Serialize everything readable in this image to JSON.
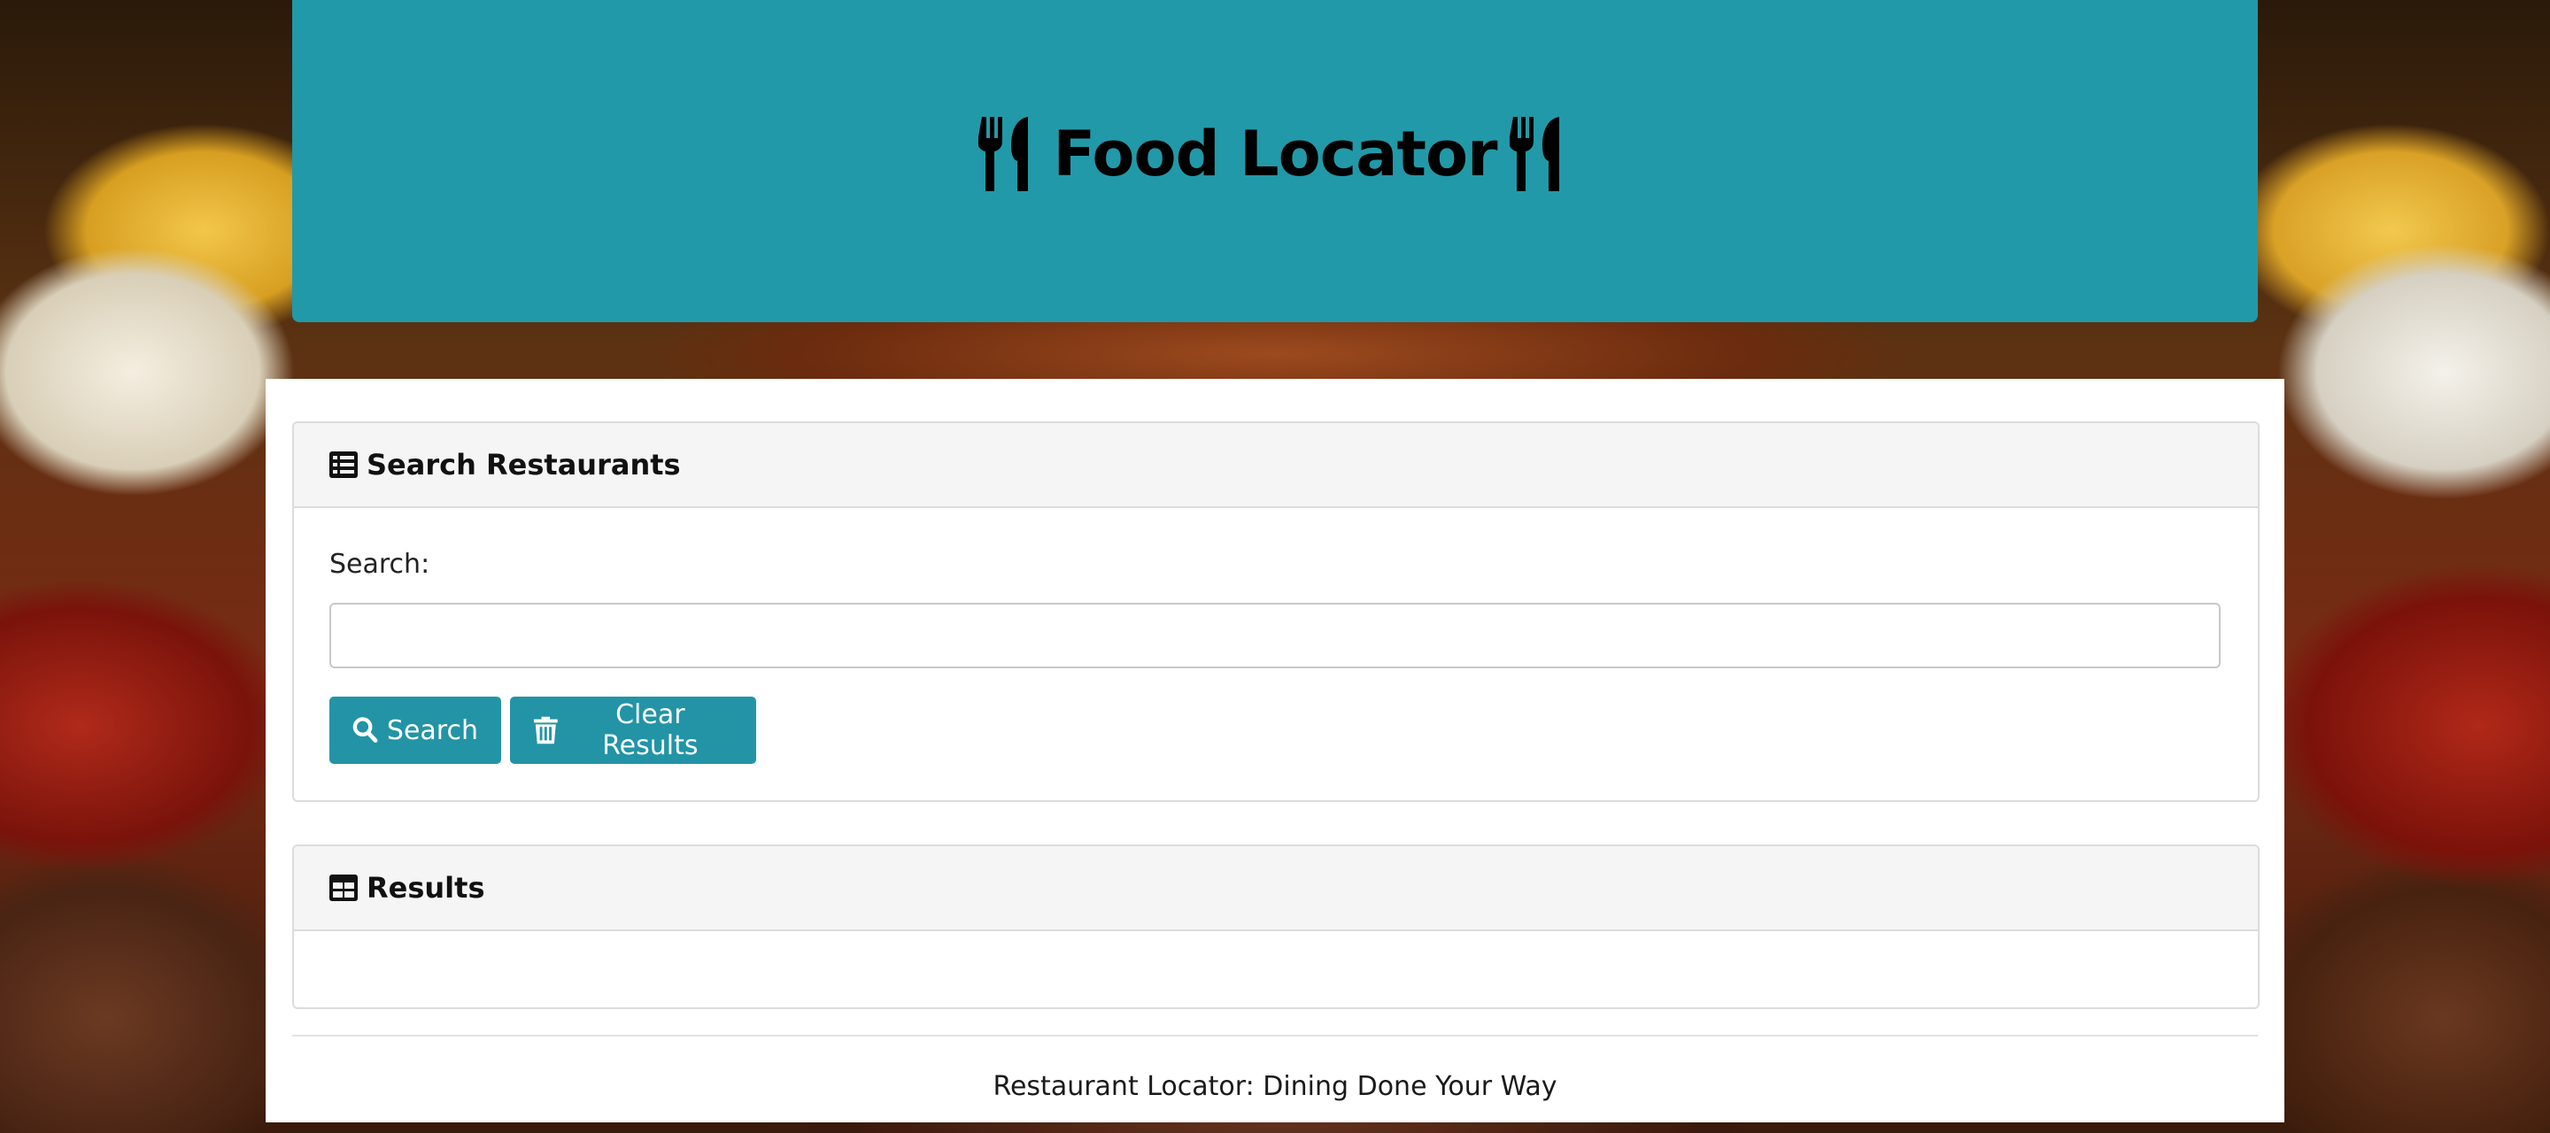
{
  "header": {
    "title": "Food Locator",
    "icon_left": "utensils-icon",
    "icon_right": "utensils-icon",
    "background_color": "#2299a8"
  },
  "search_card": {
    "title": "Search Restaurants",
    "icon": "list-icon",
    "label": "Search:",
    "input_value": "",
    "input_placeholder": "",
    "search_button_label": "Search",
    "search_button_icon": "search-icon",
    "clear_button_label": "Clear Results",
    "clear_button_icon": "trash-icon",
    "button_color": "#2294a6"
  },
  "results_card": {
    "title": "Results",
    "icon": "table-icon",
    "items": []
  },
  "footer": {
    "text": "Restaurant Locator: Dining Done Your Way"
  }
}
